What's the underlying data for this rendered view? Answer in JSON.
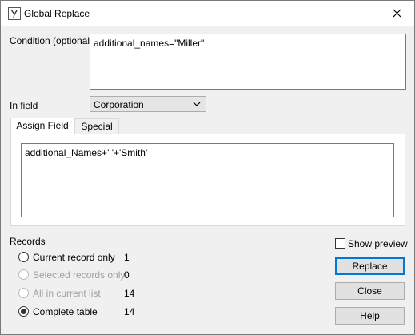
{
  "window": {
    "title": "Global Replace"
  },
  "condition": {
    "label": "Condition (optional)",
    "value": "additional_names=\"Miller\""
  },
  "in_field": {
    "label": "In field",
    "selected": "Corporation"
  },
  "tabs": [
    {
      "label": "Assign Field",
      "active": true
    },
    {
      "label": "Special",
      "active": false
    }
  ],
  "assign_field": {
    "value": "additional_Names+' '+'Smith'"
  },
  "records": {
    "label": "Records",
    "options": [
      {
        "label": "Current record only",
        "count": "1",
        "checked": false,
        "enabled": true
      },
      {
        "label": "Selected records only",
        "count": "0",
        "checked": false,
        "enabled": false
      },
      {
        "label": "All in current list",
        "count": "14",
        "checked": false,
        "enabled": false
      },
      {
        "label": "Complete table",
        "count": "14",
        "checked": true,
        "enabled": true
      }
    ]
  },
  "show_preview": {
    "label": "Show preview",
    "checked": false
  },
  "buttons": {
    "replace": "Replace",
    "close": "Close",
    "help": "Help"
  },
  "icons": {
    "app": "global-replace-app-icon",
    "close": "close-icon",
    "dropdown": "chevron-down-icon"
  }
}
